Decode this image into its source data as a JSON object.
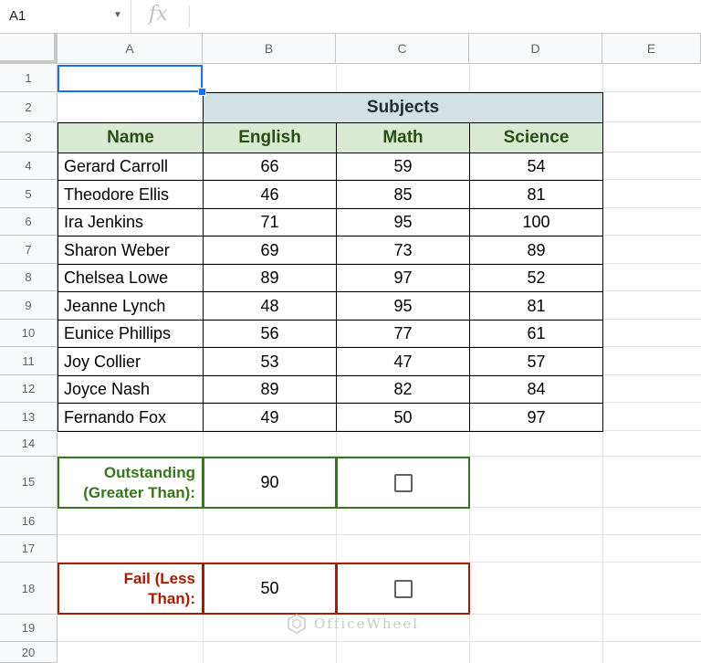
{
  "formula_bar": {
    "name_box": "A1",
    "fx_label": "fx",
    "formula": ""
  },
  "columns": [
    "A",
    "B",
    "C",
    "D",
    "E"
  ],
  "rows": [
    "1",
    "2",
    "3",
    "4",
    "5",
    "6",
    "7",
    "8",
    "9",
    "10",
    "11",
    "12",
    "13",
    "14",
    "15",
    "16",
    "17",
    "18",
    "19",
    "20"
  ],
  "table": {
    "group_header": "Subjects",
    "headers": [
      "Name",
      "English",
      "Math",
      "Science"
    ],
    "records": [
      [
        "Gerard Carroll",
        "66",
        "59",
        "54"
      ],
      [
        "Theodore Ellis",
        "46",
        "85",
        "81"
      ],
      [
        "Ira Jenkins",
        "71",
        "95",
        "100"
      ],
      [
        "Sharon Weber",
        "69",
        "73",
        "89"
      ],
      [
        "Chelsea Lowe",
        "89",
        "97",
        "52"
      ],
      [
        "Jeanne Lynch",
        "48",
        "95",
        "81"
      ],
      [
        "Eunice Phillips",
        "56",
        "77",
        "61"
      ],
      [
        "Joy Collier",
        "53",
        "47",
        "57"
      ],
      [
        "Joyce Nash",
        "89",
        "82",
        "84"
      ],
      [
        "Fernando Fox",
        "49",
        "50",
        "97"
      ]
    ]
  },
  "outstanding": {
    "label_line1": "Outstanding",
    "label_line2": "(Greater Than):",
    "value": "90",
    "checked": false,
    "border_color": "#38761d"
  },
  "fail": {
    "label_line1": "Fail (Less",
    "label_line2": "Than):",
    "value": "50",
    "checked": false,
    "border_color": "#a61c00"
  },
  "watermark": "OfficeWheel",
  "colors": {
    "header_green": "#d9ead3",
    "subjects_blue": "#d0e0e3",
    "selection": "#1a73e8"
  }
}
